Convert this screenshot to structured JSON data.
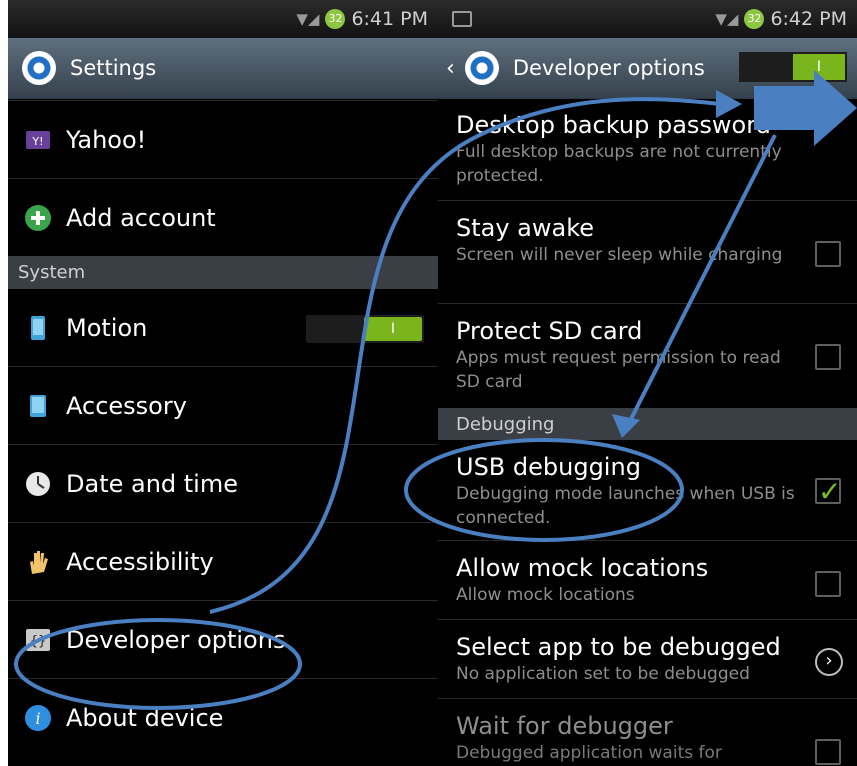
{
  "left": {
    "status": {
      "battery": "32",
      "time": "6:41 PM"
    },
    "title": "Settings",
    "items_top": [
      {
        "label": "Yahoo!",
        "icon": "yahoo-icon"
      },
      {
        "label": "Add account",
        "icon": "add-icon"
      }
    ],
    "section": "System",
    "items_system": [
      {
        "label": "Motion",
        "icon": "phone-icon",
        "toggle": "I"
      },
      {
        "label": "Accessory",
        "icon": "device-icon"
      },
      {
        "label": "Date and time",
        "icon": "clock-icon"
      },
      {
        "label": "Accessibility",
        "icon": "hand-icon"
      },
      {
        "label": "Developer options",
        "icon": "braces-icon"
      },
      {
        "label": "About device",
        "icon": "info-icon"
      }
    ]
  },
  "right": {
    "status": {
      "battery": "32",
      "time": "6:42 PM"
    },
    "back": "‹",
    "title": "Developer options",
    "master_toggle": "I",
    "items": [
      {
        "title": "Desktop backup password",
        "subtitle": "Full desktop backups are not currently protected."
      },
      {
        "title": "Stay awake",
        "subtitle": "Screen will never sleep while charging",
        "checked": false
      },
      {
        "title": "Protect SD card",
        "subtitle": "Apps must request permission to read SD card",
        "checked": false
      }
    ],
    "section": "Debugging",
    "debug_items": [
      {
        "title": "USB debugging",
        "subtitle": "Debugging mode launches when USB is connected.",
        "checked": true
      },
      {
        "title": "Allow mock locations",
        "subtitle": "Allow mock locations",
        "checked": false
      },
      {
        "title": "Select app to be debugged",
        "subtitle": "No application set to be debugged",
        "chevron": "›"
      },
      {
        "title": "Wait for debugger",
        "subtitle": "Debugged application waits for",
        "checked": false
      }
    ]
  },
  "colors": {
    "annotation": "#4a7fc1",
    "toggle_on": "#7ab51d",
    "check": "#79c11f"
  }
}
